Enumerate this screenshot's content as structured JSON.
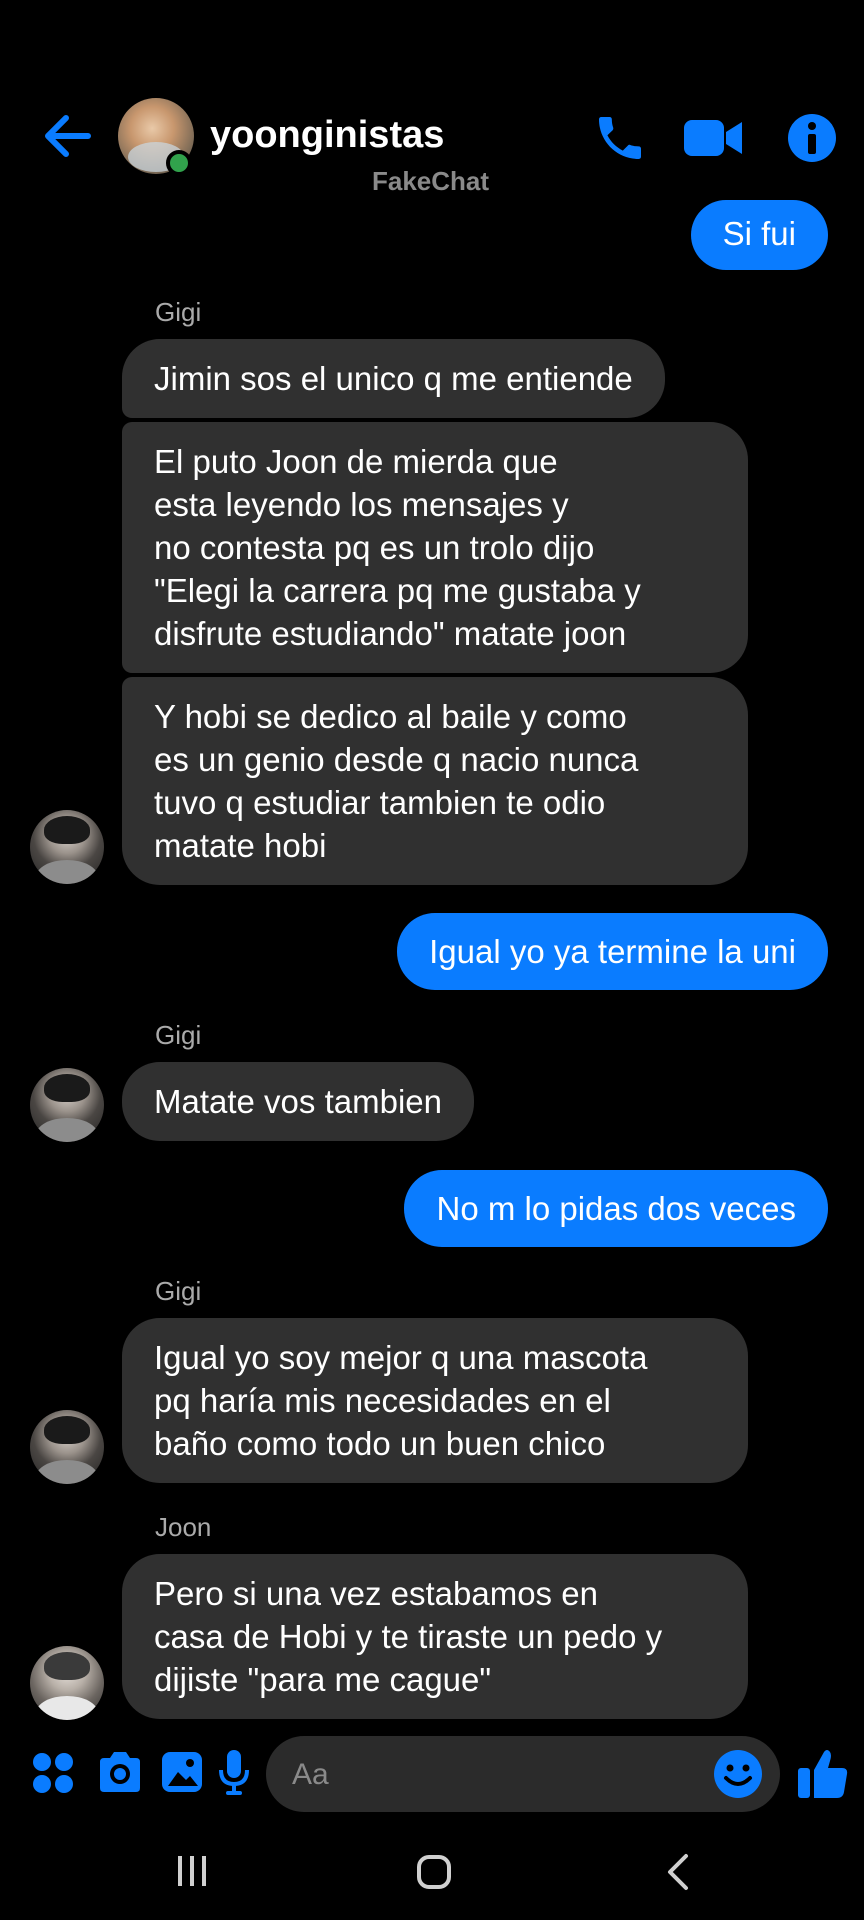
{
  "header": {
    "title": "yoonginistas",
    "subtitle": "FakeChat",
    "back_icon": "arrow-left-icon",
    "call_icon": "phone-icon",
    "video_icon": "video-camera-icon",
    "info_icon": "info-icon",
    "online": true
  },
  "messages": [
    {
      "direction": "outgoing",
      "text": "Si fui"
    },
    {
      "direction": "incoming",
      "sender": "Gigi",
      "text": "Jimin sos el unico q me entiende"
    },
    {
      "direction": "incoming",
      "text": "El puto Joon de mierda que\nesta leyendo los mensajes y\nno contesta pq es un trolo dijo\n\"Elegi la carrera pq me gustaba y\ndisfrute estudiando\" matate joon"
    },
    {
      "direction": "incoming",
      "text": "Y hobi se dedico al baile y como\nes un genio desde q nacio nunca\ntuvo q estudiar tambien te odio\nmatate hobi"
    },
    {
      "direction": "outgoing",
      "text": "Igual yo ya termine la uni"
    },
    {
      "direction": "incoming",
      "sender": "Gigi",
      "text": "Matate vos tambien"
    },
    {
      "direction": "outgoing",
      "text": "No m lo pidas dos veces"
    },
    {
      "direction": "incoming",
      "sender": "Gigi",
      "text": "Igual yo soy mejor q una mascota\npq haría mis necesidades en el\nbaño como todo un buen chico"
    },
    {
      "direction": "incoming",
      "sender": "Joon",
      "text": "Pero si una vez estabamos en\ncasa de Hobi y te tiraste un pedo y\ndijiste \"para me cague\""
    }
  ],
  "composer": {
    "placeholder": "Aa",
    "icons": [
      "apps-icon",
      "camera-icon",
      "photo-icon",
      "microphone-icon",
      "emoji-icon",
      "thumbs-up-icon"
    ]
  },
  "nav": {
    "icons": [
      "recent-apps-icon",
      "home-icon",
      "back-icon"
    ]
  },
  "colors": {
    "background": "#000000",
    "accent": "#0a7cff",
    "incoming_bubble": "#303030",
    "online": "#31a24c"
  }
}
